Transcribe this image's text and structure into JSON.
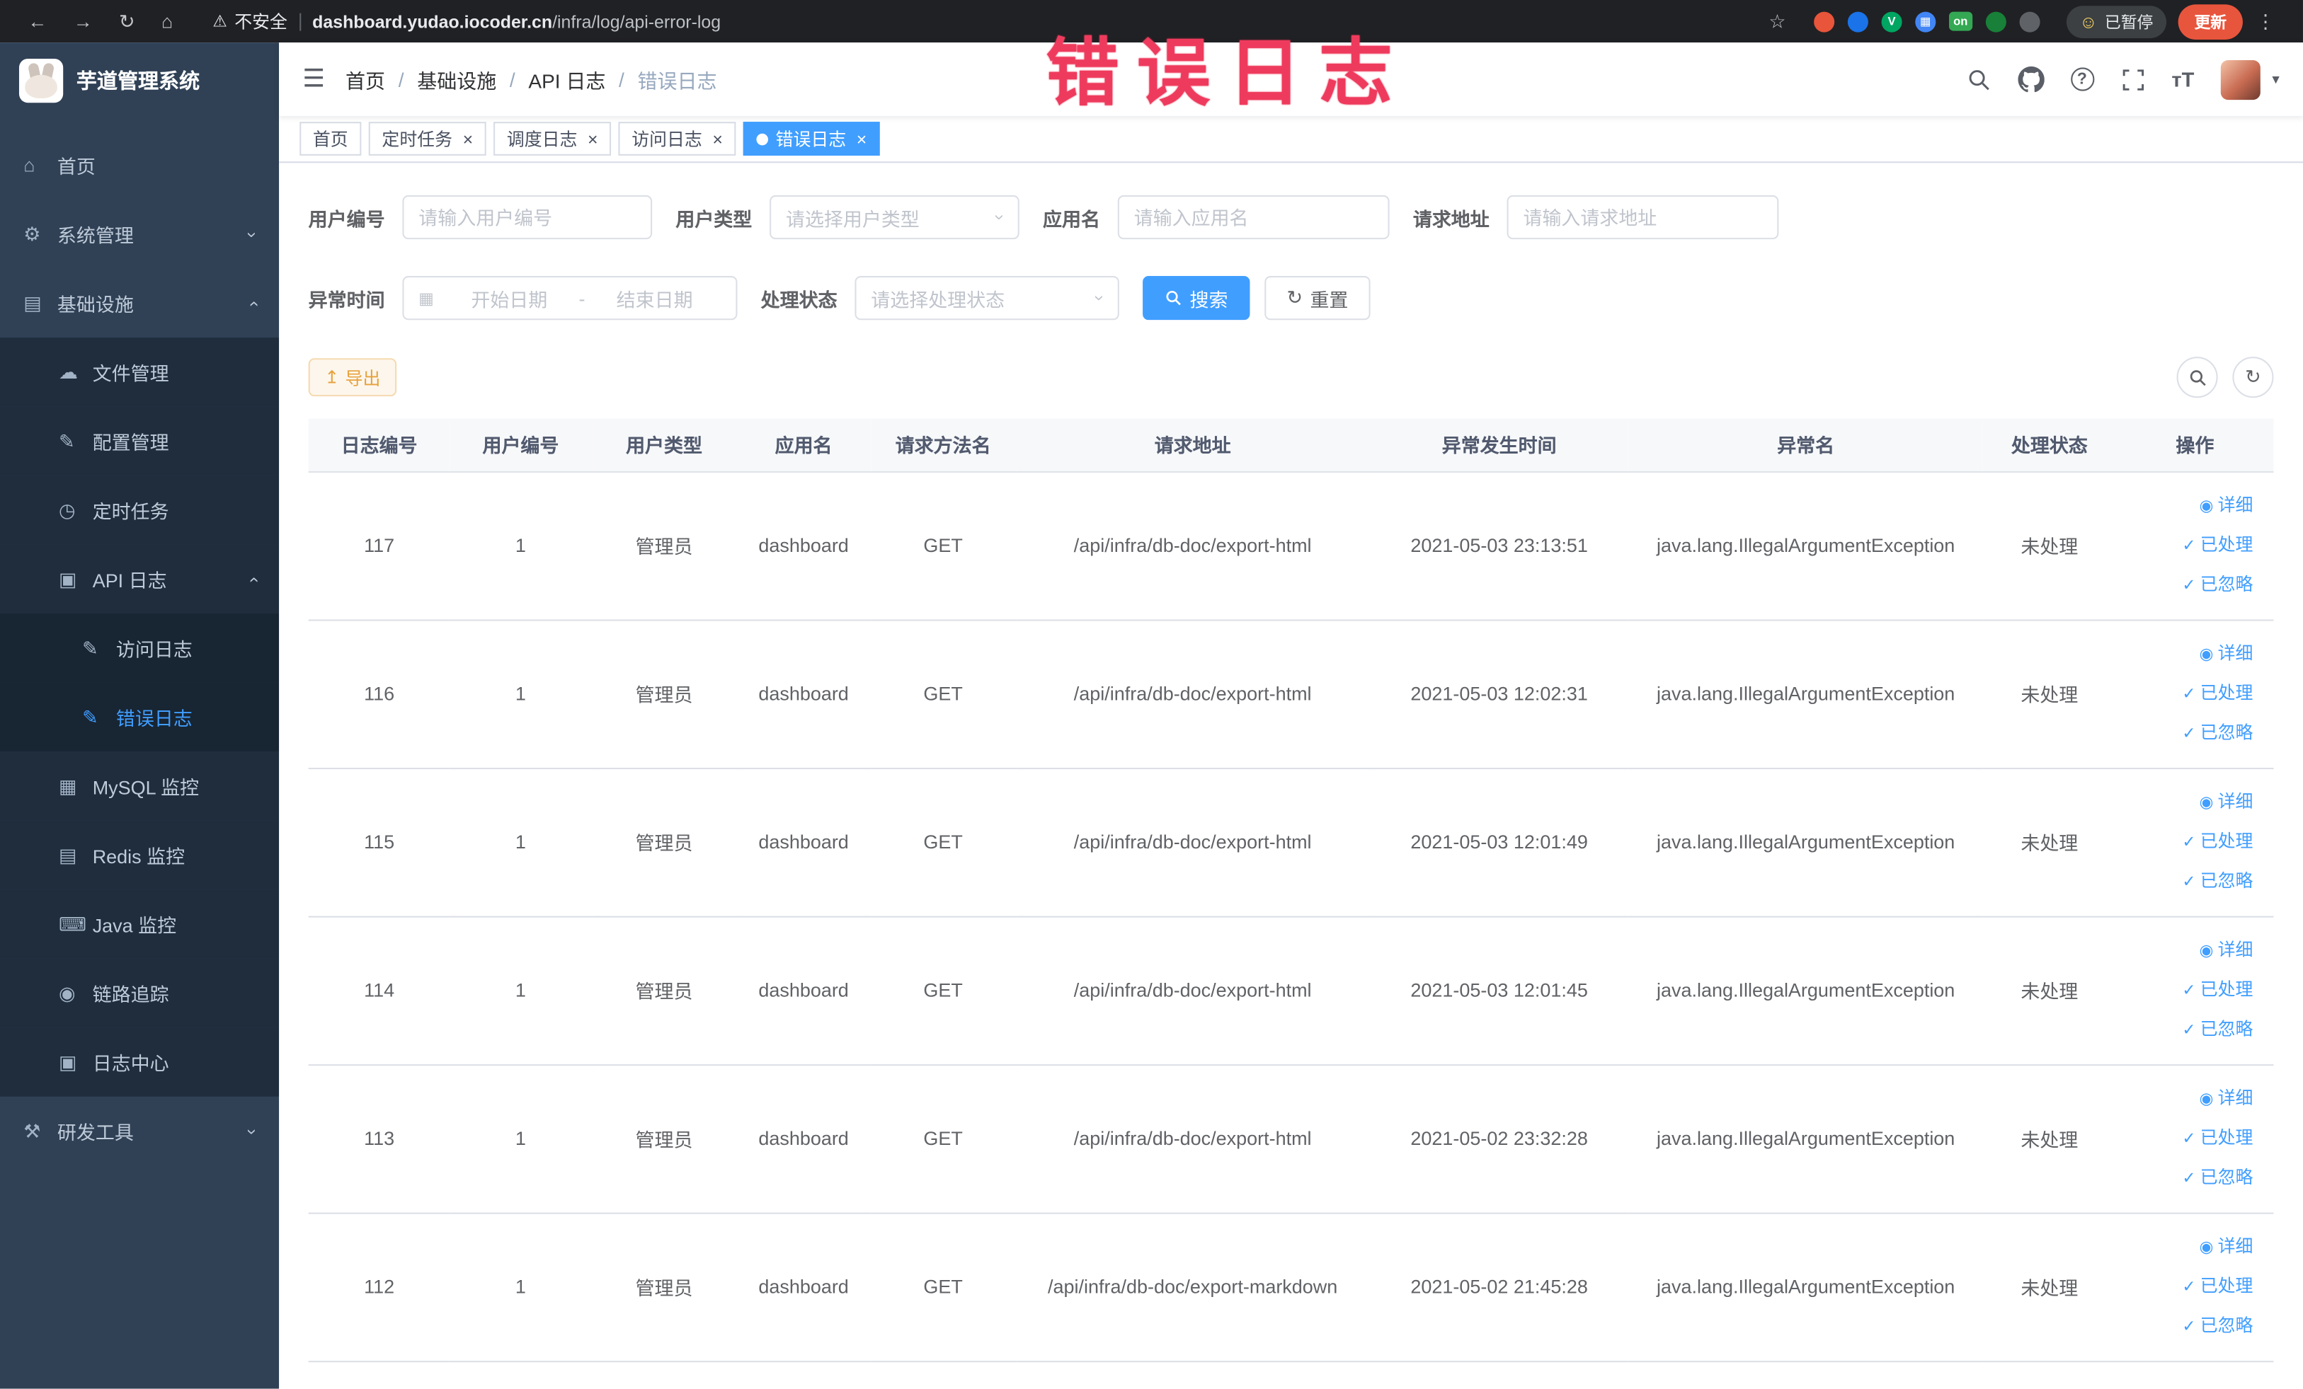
{
  "icons": {
    "back-icon": "←",
    "forward-icon": "→",
    "reload-icon": "↻",
    "home-icon": "⌂",
    "warning-icon": "⚠",
    "star-icon": "☆",
    "kebab-icon": "⋮",
    "caret-down-icon": "▾",
    "hamburger-icon": "☰",
    "help-icon": "?",
    "font-size-icon": "тT",
    "menu-home-icon": "⌂",
    "menu-gear-icon": "⚙",
    "menu-infra-icon": "▤",
    "menu-file-icon": "☁",
    "menu-config-icon": "✎",
    "menu-timer-icon": "◷",
    "menu-apilog-icon": "▣",
    "menu-doc-icon": "✎",
    "menu-mysql-icon": "▦",
    "menu-redis-icon": "▤",
    "menu-java-icon": "⌨",
    "menu-trace-icon": "◉",
    "menu-logcenter-icon": "▣",
    "menu-tools-icon": "⚒",
    "calendar-icon": "▦",
    "refresh-icon": "↻",
    "export-icon": "↥",
    "eye-icon": "◉",
    "check-icon": "✓",
    "chevron-glyph": "›",
    "smiley-icon": "☺"
  },
  "browser": {
    "security_label": "不安全",
    "url_domain": "dashboard.yudao.iocoder.cn",
    "url_path": "/infra/log/api-error-log",
    "paused_badge": "已暂停",
    "update_button": "更新",
    "extensions": [
      {
        "name": "extension-red-icon",
        "color": "#e8553a",
        "glyph": ""
      },
      {
        "name": "extension-blue-drop-icon",
        "color": "#1a73e8",
        "glyph": ""
      },
      {
        "name": "extension-green-v-icon",
        "color": "#00a661",
        "glyph": "V"
      },
      {
        "name": "extension-blue-grid-icon",
        "color": "#4285f4",
        "glyph": "▦"
      },
      {
        "name": "extension-on-badge-icon",
        "color": "#34a853",
        "glyph": "on"
      },
      {
        "name": "extension-leaf-icon",
        "color": "#188038",
        "glyph": ""
      },
      {
        "name": "extension-dark-icon",
        "color": "#5f6368",
        "glyph": ""
      }
    ]
  },
  "annotation": {
    "text": "错误日志"
  },
  "sidebar": {
    "logo_title": "芋道管理系统",
    "items": [
      {
        "id": "home",
        "label": "首页",
        "icon": "menu-home-icon",
        "level": 1
      },
      {
        "id": "system",
        "label": "系统管理",
        "icon": "menu-gear-icon",
        "level": 1,
        "arrow": "down"
      },
      {
        "id": "infra",
        "label": "基础设施",
        "icon": "menu-infra-icon",
        "level": 1,
        "arrow": "up"
      },
      {
        "id": "file",
        "label": "文件管理",
        "icon": "menu-file-icon",
        "level": 2
      },
      {
        "id": "config",
        "label": "配置管理",
        "icon": "menu-config-icon",
        "level": 2
      },
      {
        "id": "job",
        "label": "定时任务",
        "icon": "menu-timer-icon",
        "level": 2
      },
      {
        "id": "api-log",
        "label": "API 日志",
        "icon": "menu-apilog-icon",
        "level": 2,
        "arrow": "up"
      },
      {
        "id": "access-log",
        "label": "访问日志",
        "icon": "menu-doc-icon",
        "level": 3
      },
      {
        "id": "error-log",
        "label": "错误日志",
        "icon": "menu-doc-icon",
        "level": 3,
        "active": true
      },
      {
        "id": "mysql",
        "label": "MySQL 监控",
        "icon": "menu-mysql-icon",
        "level": 2
      },
      {
        "id": "redis",
        "label": "Redis 监控",
        "icon": "menu-redis-icon",
        "level": 2
      },
      {
        "id": "java",
        "label": "Java 监控",
        "icon": "menu-java-icon",
        "level": 2
      },
      {
        "id": "trace",
        "label": "链路追踪",
        "icon": "menu-trace-icon",
        "level": 2
      },
      {
        "id": "log-center",
        "label": "日志中心",
        "icon": "menu-logcenter-icon",
        "level": 2
      },
      {
        "id": "dev-tools",
        "label": "研发工具",
        "icon": "menu-tools-icon",
        "level": 1,
        "arrow": "down"
      }
    ]
  },
  "breadcrumb": {
    "separator": "/",
    "items": [
      "首页",
      "基础设施",
      "API 日志",
      "错误日志"
    ]
  },
  "tabs": [
    {
      "label": "首页",
      "closable": false,
      "active": false
    },
    {
      "label": "定时任务",
      "closable": true,
      "active": false
    },
    {
      "label": "调度日志",
      "closable": true,
      "active": false
    },
    {
      "label": "访问日志",
      "closable": true,
      "active": false
    },
    {
      "label": "错误日志",
      "closable": true,
      "active": true
    }
  ],
  "filters": {
    "user_id": {
      "label": "用户编号",
      "placeholder": "请输入用户编号"
    },
    "user_type": {
      "label": "用户类型",
      "placeholder": "请选择用户类型"
    },
    "app_name": {
      "label": "应用名",
      "placeholder": "请输入应用名"
    },
    "request_url": {
      "label": "请求地址",
      "placeholder": "请输入请求地址"
    },
    "exception_time": {
      "label": "异常时间",
      "start_placeholder": "开始日期",
      "separator": "-",
      "end_placeholder": "结束日期"
    },
    "process_status": {
      "label": "处理状态",
      "placeholder": "请选择处理状态"
    },
    "search_button": "搜索",
    "reset_button": "重置"
  },
  "toolbar": {
    "export_button": "导出"
  },
  "table": {
    "headers": [
      "日志编号",
      "用户编号",
      "用户类型",
      "应用名",
      "请求方法名",
      "请求地址",
      "异常发生时间",
      "异常名",
      "处理状态",
      "操作"
    ],
    "row_actions": [
      {
        "name": "detail",
        "label": "详细",
        "icon": "eye-icon"
      },
      {
        "name": "processed",
        "label": "已处理",
        "icon": "check-icon"
      },
      {
        "name": "ignore",
        "label": "已忽略",
        "icon": "check-icon"
      }
    ],
    "rows": [
      {
        "id": "117",
        "user_id": "1",
        "user_type": "管理员",
        "app": "dashboard",
        "method": "GET",
        "url": "/api/infra/db-doc/export-html",
        "time": "2021-05-03 23:13:51",
        "exception": "java.lang.IllegalArgumentException",
        "status": "未处理"
      },
      {
        "id": "116",
        "user_id": "1",
        "user_type": "管理员",
        "app": "dashboard",
        "method": "GET",
        "url": "/api/infra/db-doc/export-html",
        "time": "2021-05-03 12:02:31",
        "exception": "java.lang.IllegalArgumentException",
        "status": "未处理"
      },
      {
        "id": "115",
        "user_id": "1",
        "user_type": "管理员",
        "app": "dashboard",
        "method": "GET",
        "url": "/api/infra/db-doc/export-html",
        "time": "2021-05-03 12:01:49",
        "exception": "java.lang.IllegalArgumentException",
        "status": "未处理"
      },
      {
        "id": "114",
        "user_id": "1",
        "user_type": "管理员",
        "app": "dashboard",
        "method": "GET",
        "url": "/api/infra/db-doc/export-html",
        "time": "2021-05-03 12:01:45",
        "exception": "java.lang.IllegalArgumentException",
        "status": "未处理"
      },
      {
        "id": "113",
        "user_id": "1",
        "user_type": "管理员",
        "app": "dashboard",
        "method": "GET",
        "url": "/api/infra/db-doc/export-html",
        "time": "2021-05-02 23:32:28",
        "exception": "java.lang.IllegalArgumentException",
        "status": "未处理"
      },
      {
        "id": "112",
        "user_id": "1",
        "user_type": "管理员",
        "app": "dashboard",
        "method": "GET",
        "url": "/api/infra/db-doc/export-markdown",
        "time": "2021-05-02 21:45:28",
        "exception": "java.lang.IllegalArgumentException",
        "status": "未处理"
      }
    ]
  }
}
